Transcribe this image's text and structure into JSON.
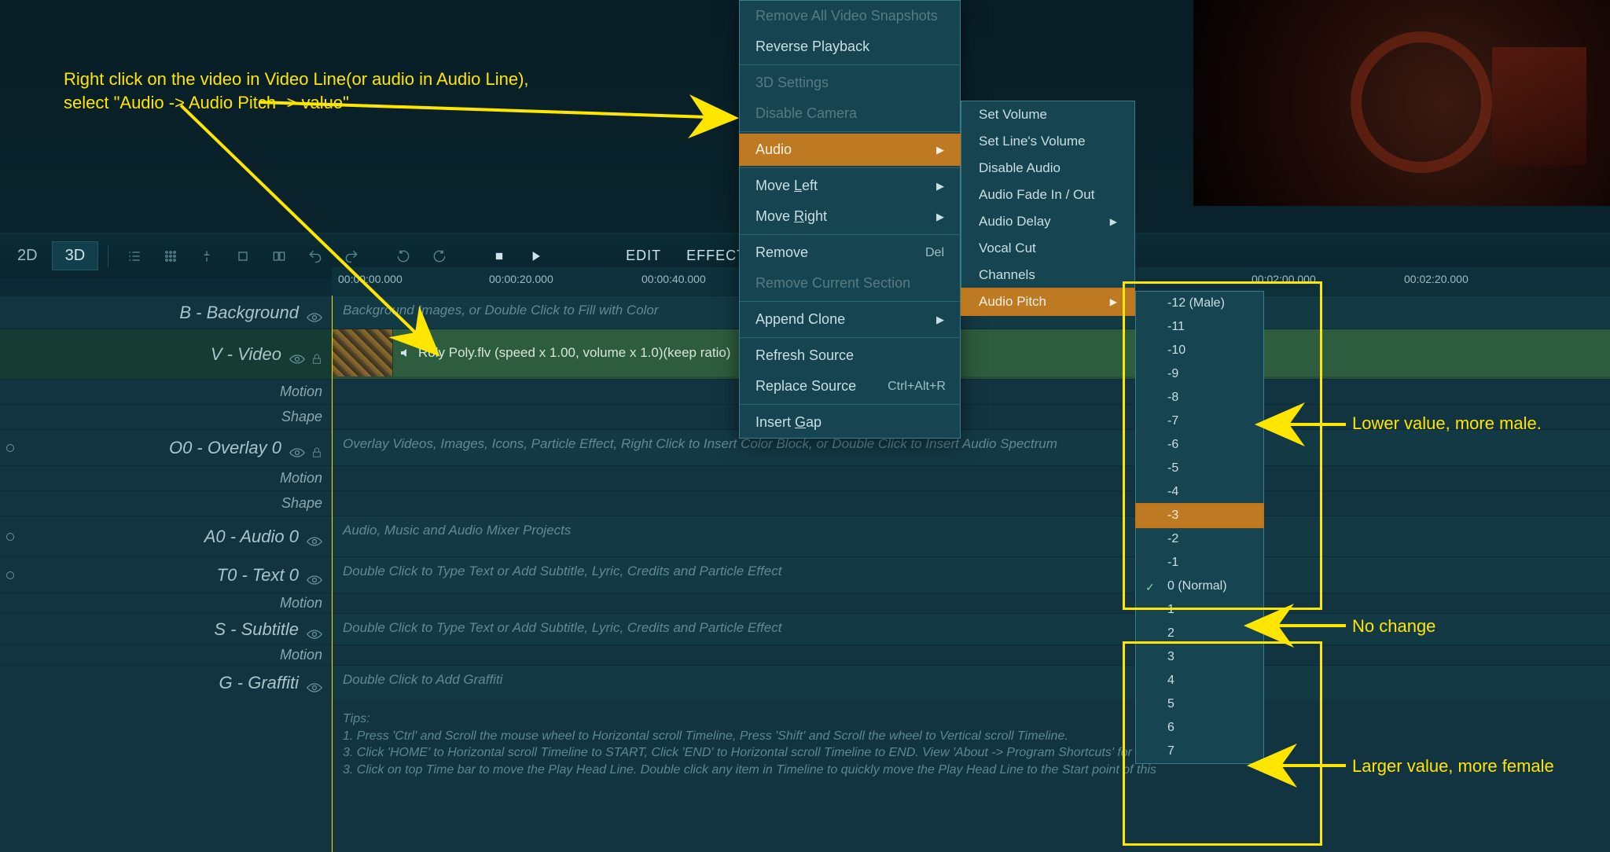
{
  "annotations": {
    "instruction_line1": "Right click on the video in Video Line(or audio in Audio Line),",
    "instruction_line2": "select \"Audio -> Audio Pitch -> value\"",
    "lower_value": "Lower value, more male.",
    "no_change": "No change",
    "larger_value": "Larger value, more female"
  },
  "toolbar": {
    "mode_2d": "2D",
    "mode_3d": "3D",
    "edit": "EDIT",
    "effect": "EFFECT"
  },
  "ruler": {
    "labels": [
      "00:00:00.000",
      "00:00:20.000",
      "00:00:40.000",
      "00:02:00.000",
      "00:02:20.000"
    ]
  },
  "tracks": {
    "background": {
      "label": "B - Background",
      "hint": "Background Images, or Double Click to Fill with Color"
    },
    "video": {
      "label": "V - Video",
      "clip": "Roly Poly.flv  (speed x 1.00, volume x 1.0)(keep ratio)",
      "motion": "Motion",
      "shape": "Shape"
    },
    "overlay0": {
      "label": "O0 - Overlay 0",
      "hint": "Overlay Videos, Images, Icons, Particle Effect, Right Click to Insert Color Block, or Double Click to Insert Audio Spectrum",
      "motion": "Motion",
      "shape": "Shape"
    },
    "audio0": {
      "label": "A0 - Audio 0",
      "hint": "Audio, Music and Audio Mixer Projects"
    },
    "text0": {
      "label": "T0 - Text 0",
      "hint": "Double Click to Type Text or Add Subtitle, Lyric, Credits and Particle Effect",
      "motion": "Motion"
    },
    "subtitle": {
      "label": "S - Subtitle",
      "hint": "Double Click to Type Text or Add Subtitle, Lyric, Credits and Particle Effect",
      "motion": "Motion"
    },
    "graffiti": {
      "label": "G - Graffiti",
      "hint": "Double Click to Add Graffiti"
    }
  },
  "tips": {
    "t0": "Tips:",
    "t1": "1. Press 'Ctrl' and Scroll the mouse wheel to Horizontal scroll Timeline, Press 'Shift' and Scroll the wheel to Vertical scroll Timeline.",
    "t2": "3. Click 'HOME' to Horizontal scroll Timeline to START, Click 'END' to Horizontal scroll Timeline to END. View 'About -> Program Shortcuts' for mo",
    "t3": "3. Click on top Time bar to move the Play Head Line. Double click any item in Timeline to quickly move the Play Head Line to the Start point of this"
  },
  "context_menu": {
    "remove_all_snapshots": "Remove All Video Snapshots",
    "reverse_playback": "Reverse Playback",
    "settings_3d": "3D Settings",
    "disable_camera": "Disable Camera",
    "audio": "Audio",
    "move_left": "Move Left",
    "move_right": "Move Right",
    "remove": "Remove",
    "remove_sc": "Del",
    "remove_section": "Remove Current Section",
    "append_clone": "Append Clone",
    "refresh_source": "Refresh Source",
    "replace_source": "Replace Source",
    "replace_sc": "Ctrl+Alt+R",
    "insert_gap": "Insert Gap"
  },
  "audio_submenu": {
    "set_volume": "Set Volume",
    "set_line_volume": "Set Line's Volume",
    "disable_audio": "Disable Audio",
    "fade": "Audio Fade In / Out",
    "delay": "Audio Delay",
    "vocal_cut": "Vocal Cut",
    "channels": "Channels",
    "pitch": "Audio Pitch"
  },
  "pitch_menu": {
    "items": [
      "-12 (Male)",
      "-11",
      "-10",
      "-9",
      "-8",
      "-7",
      "-6",
      "-5",
      "-4",
      "-3",
      "-2",
      "-1",
      "0 (Normal)",
      "1",
      "2",
      "3",
      "4",
      "5",
      "6",
      "7"
    ],
    "selected_index": 9,
    "checked_index": 12
  }
}
